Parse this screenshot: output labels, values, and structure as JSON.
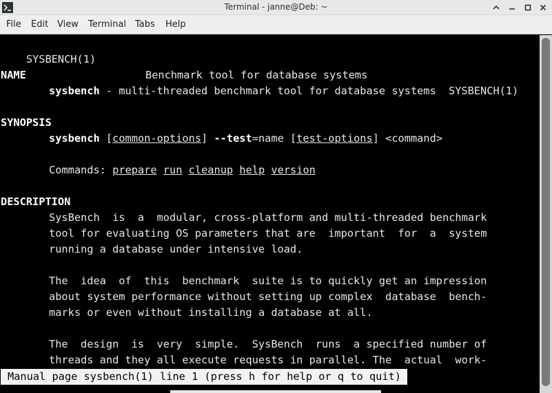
{
  "window": {
    "title": "Terminal - janne@Deb: ~"
  },
  "menu": [
    "File",
    "Edit",
    "View",
    "Terminal",
    "Tabs",
    "Help"
  ],
  "man": {
    "header_left": "SYSBENCH(1)",
    "header_center": "Benchmark tool for database systems",
    "header_right": "SYSBENCH(1)",
    "name_heading": "NAME",
    "name_cmd": "sysbench",
    "name_desc": " - multi-threaded benchmark tool for database systems",
    "synopsis_heading": "SYNOPSIS",
    "syn_cmd": "sysbench",
    "syn_open1": " [",
    "syn_common": "common-options",
    "syn_close1": "] ",
    "syn_test": "--test",
    "syn_eq": "=name [",
    "syn_testopts": "test-options",
    "syn_close2": "] <command>",
    "commands_label": "Commands: ",
    "commands": [
      "prepare",
      "run",
      "cleanup",
      "help",
      "version"
    ],
    "description_heading": "DESCRIPTION",
    "desc_lines": [
      "SysBench  is  a  modular, cross-platform and multi-threaded benchmark",
      "tool for evaluating OS parameters that are  important  for  a  system",
      "running a database under intensive load.",
      "",
      "The  idea  of  this  benchmark  suite is to quickly get an impression",
      "about system performance without setting up complex  database  bench-",
      "marks or even without installing a database at all.",
      "",
      "The  design  is  very  simple.  SysBench  runs  a specified number of",
      "threads and they all execute requests in parallel. The  actual  work-"
    ],
    "status": "Manual page sysbench(1) line 1 (press h for help or q to quit)"
  }
}
